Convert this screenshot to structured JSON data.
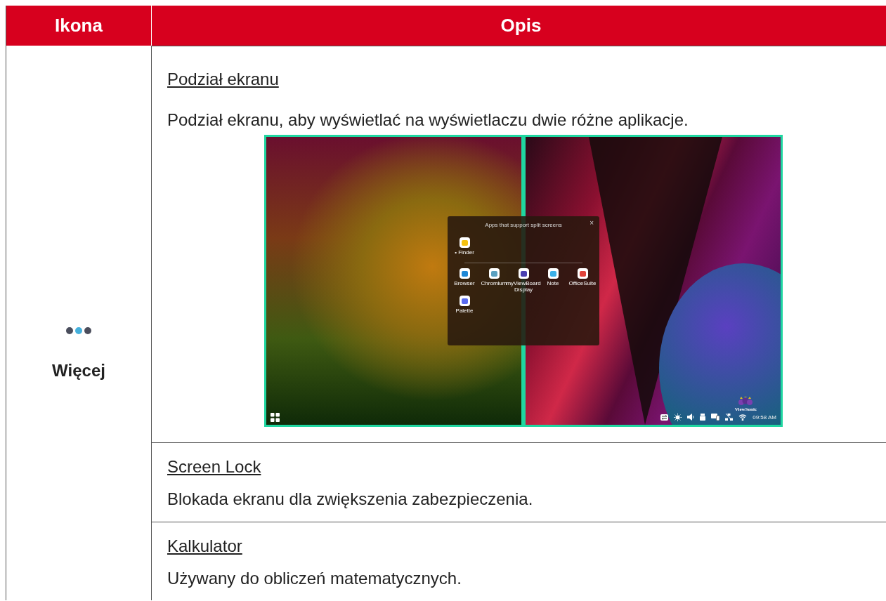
{
  "table": {
    "columns": [
      "Ikona",
      "Opis"
    ],
    "icon_cell": {
      "dots": [
        {
          "color": "#4a4d5c"
        },
        {
          "color": "#45b0dc"
        },
        {
          "color": "#4a4d5c"
        }
      ],
      "label": "Więcej"
    },
    "rows": [
      {
        "title": "Podział ekranu",
        "description": "Podział ekranu, aby wyświetlać na wyświetlaczu dwie różne aplikacje.",
        "screenshot": {
          "dialog_title": "Apps that support split screens",
          "close": "×",
          "brand": "ViewSonic",
          "time": "09:58 AM",
          "app_groups": [
            [
              {
                "label": "• Finder",
                "color": "#f5c211"
              }
            ],
            [
              {
                "label": "Browser",
                "color": "#1e88d6"
              },
              {
                "label": "Chromium",
                "color": "#5aa0c0"
              },
              {
                "label": "myViewBoard Display",
                "color": "#4a3fb0"
              },
              {
                "label": "Note",
                "color": "#3ab0e8"
              },
              {
                "label": "OfficeSuite",
                "color": "#e0433a"
              },
              {
                "label": "Palette",
                "color": "#5b6cf0"
              }
            ]
          ]
        }
      },
      {
        "title": "Screen Lock",
        "description": "Blokada ekranu dla zwiększenia zabezpieczenia."
      },
      {
        "title": "Kalkulator",
        "description": "Używany do obliczeń matematycznych."
      }
    ]
  }
}
